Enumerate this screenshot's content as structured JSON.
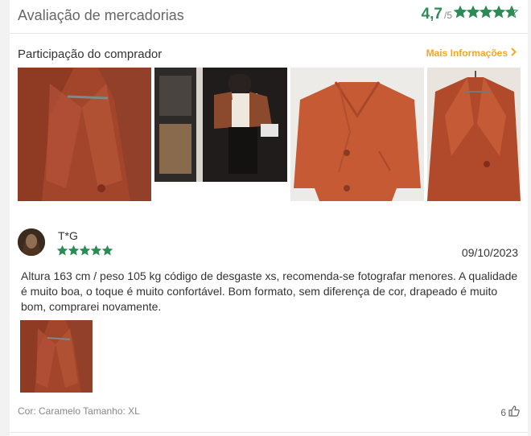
{
  "header": {
    "title": "Avaliação de mercadorias",
    "score": "4,7",
    "out_of": "/5",
    "rating_value": 4.7,
    "star_color": "#2e8b57"
  },
  "buyer_photos": {
    "title": "Participação do comprador",
    "more_label": "Mais Informações",
    "items": [
      {
        "name": "photo-coat-collar-closeup"
      },
      {
        "name": "photo-person-wearing-coat"
      },
      {
        "name": "photo-coat-flat-lay"
      },
      {
        "name": "photo-coat-on-hanger"
      }
    ]
  },
  "review": {
    "reviewer": "T*G",
    "stars": 5,
    "date": "09/10/2023",
    "text": "Altura 163 cm / peso 105 kg código de desgaste xs, recomenda-se fotografar menores. A qualidade é muito boa, o toque é muito confortável. Bom formato, sem diferença de cor, drapeado é muito bom, comprarei novamente.",
    "attributes": "Cor: Caramelo Tamanho: XL",
    "likes": "6"
  },
  "colors": {
    "accent_green": "#2e8b57",
    "link_orange": "#f5a623",
    "coat_rust": "#a8482a"
  }
}
